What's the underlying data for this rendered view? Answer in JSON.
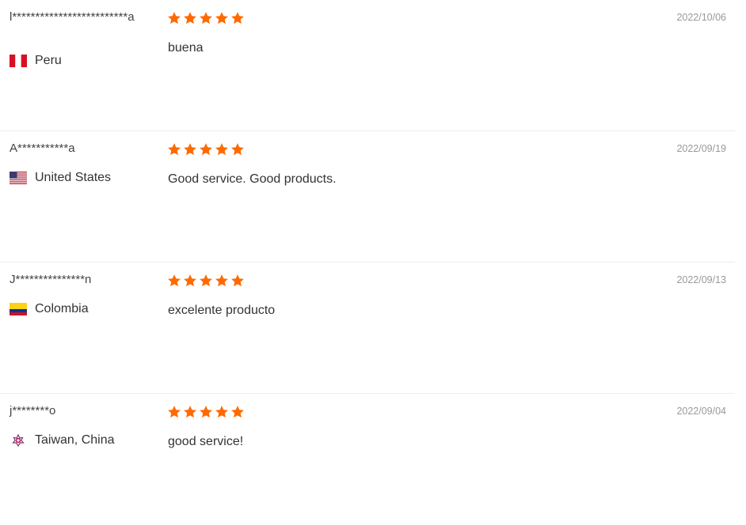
{
  "reviews": [
    {
      "user": "l************************​*a",
      "country": "Peru",
      "flag": "peru-flag-icon",
      "rating": 5,
      "feedback": "buena",
      "date": "2022/10/06"
    },
    {
      "user": "A***********a",
      "country": "United States",
      "flag": "united-states-flag-icon",
      "rating": 5,
      "feedback": "Good service. Good products.",
      "date": "2022/09/19"
    },
    {
      "user": "J***************n",
      "country": "Colombia",
      "flag": "colombia-flag-icon",
      "rating": 5,
      "feedback": "excelente producto",
      "date": "2022/09/13"
    },
    {
      "user": "j********o",
      "country": "Taiwan, China",
      "flag": "taiwan-flag-icon",
      "rating": 5,
      "feedback": "good service!",
      "date": "2022/09/04"
    }
  ],
  "colors": {
    "star": "#ff6a00",
    "date": "#999999",
    "divider": "#eeeeee"
  }
}
